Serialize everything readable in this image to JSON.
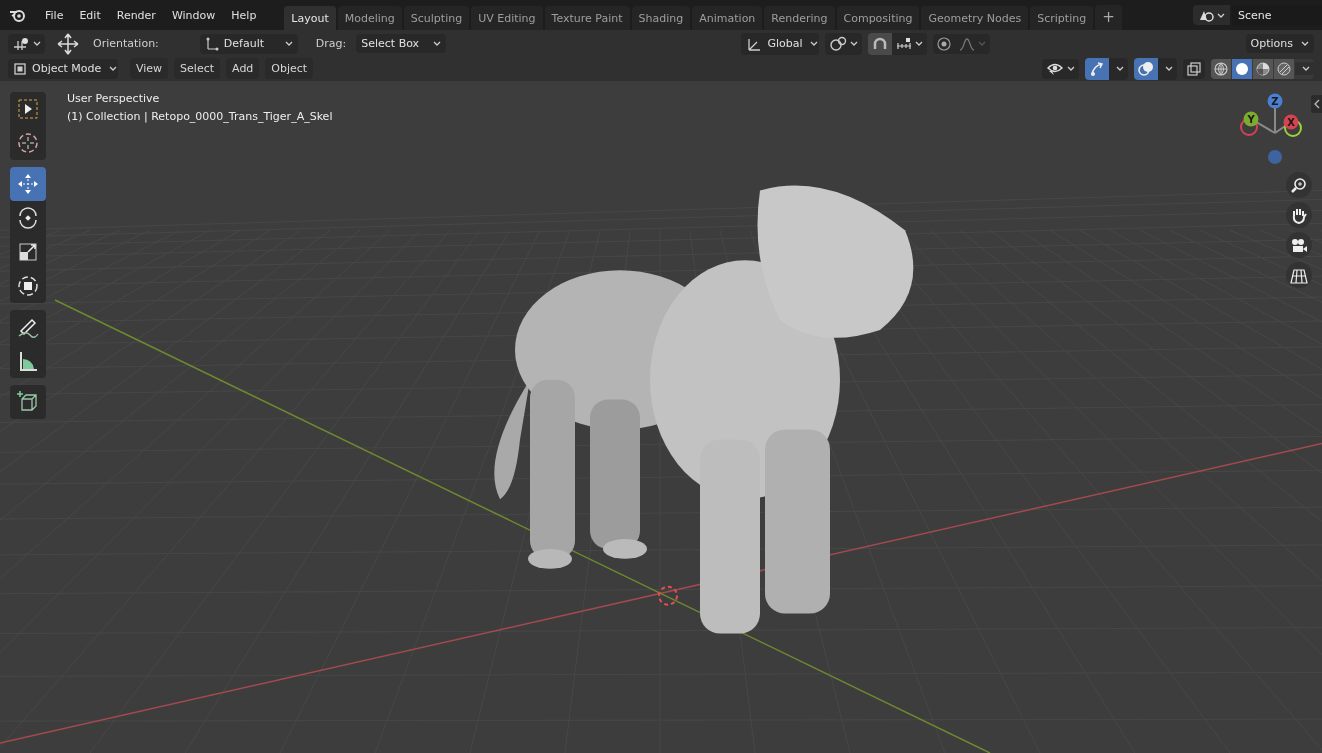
{
  "menubar": {
    "menus": [
      "File",
      "Edit",
      "Render",
      "Window",
      "Help"
    ]
  },
  "workspaces": [
    {
      "label": "Layout",
      "selected": true
    },
    {
      "label": "Modeling",
      "selected": false
    },
    {
      "label": "Sculpting",
      "selected": false
    },
    {
      "label": "UV Editing",
      "selected": false
    },
    {
      "label": "Texture Paint",
      "selected": false
    },
    {
      "label": "Shading",
      "selected": false
    },
    {
      "label": "Animation",
      "selected": false
    },
    {
      "label": "Rendering",
      "selected": false
    },
    {
      "label": "Compositing",
      "selected": false
    },
    {
      "label": "Geometry Nodes",
      "selected": false
    },
    {
      "label": "Scripting",
      "selected": false
    }
  ],
  "add_workspace": "+",
  "scene": {
    "name": "Scene"
  },
  "tool_header": {
    "orientation_label": "Orientation:",
    "orientation": "Default",
    "drag_label": "Drag:",
    "drag": "Select Box",
    "transform_orientation": "Global",
    "options": "Options"
  },
  "viewport_header": {
    "mode": "Object Mode",
    "menus": [
      "View",
      "Select",
      "Add",
      "Object"
    ],
    "gizmos_on": true,
    "overlays_on": true,
    "xray_on": false,
    "shading": [
      {
        "kind": "wireframe",
        "selected": false
      },
      {
        "kind": "solid",
        "selected": true
      },
      {
        "kind": "material",
        "selected": false
      },
      {
        "kind": "rendered",
        "selected": false
      }
    ]
  },
  "tool_groups": [
    [
      {
        "kind": "select",
        "selected": false
      },
      {
        "kind": "cursor",
        "selected": false
      }
    ],
    [
      {
        "kind": "move",
        "selected": true
      },
      {
        "kind": "rotate",
        "selected": false
      },
      {
        "kind": "scale",
        "selected": false
      },
      {
        "kind": "transform",
        "selected": false
      }
    ],
    [
      {
        "kind": "annotate",
        "selected": false
      },
      {
        "kind": "measure",
        "selected": false
      }
    ],
    [
      {
        "kind": "add_cube",
        "selected": false
      }
    ]
  ],
  "viewport": {
    "view_name": "User Perspective",
    "object_info": "(1) Collection | Retopo_0000_Trans_Tiger_A_Skel",
    "gizmo_labels": [
      "Z",
      "Y",
      "X"
    ],
    "scene_picture": {
      "kind": "picture"
    }
  }
}
